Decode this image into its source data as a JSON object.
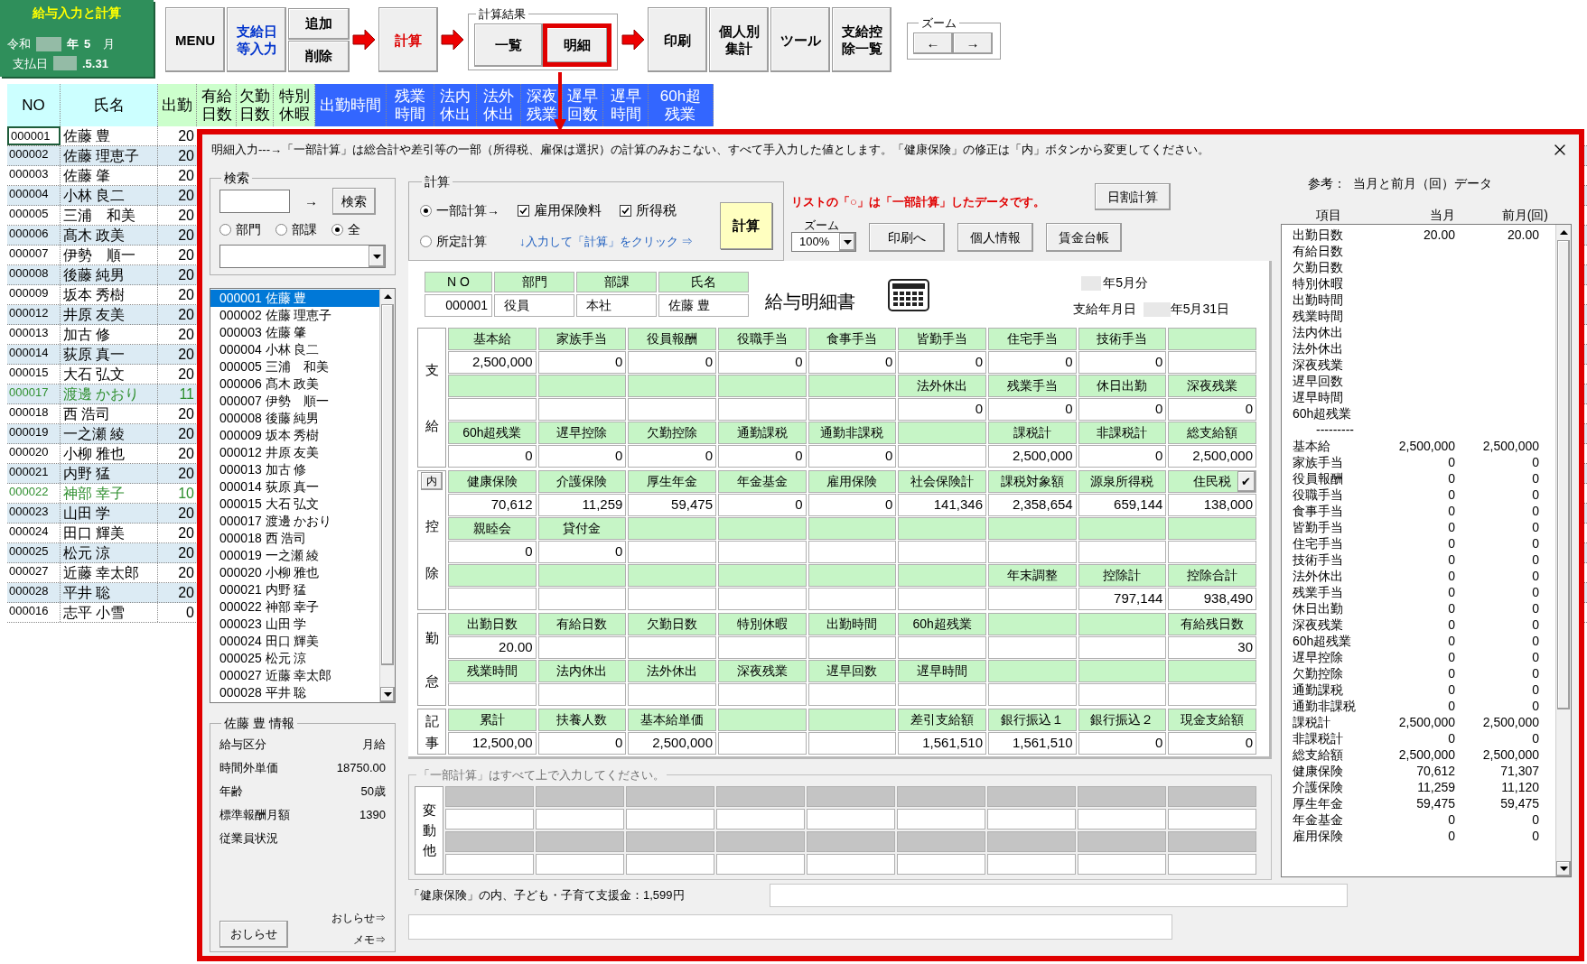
{
  "badge": {
    "title": "給与入力と計算",
    "era": "令和",
    "year_unit": "年",
    "month": "5",
    "month_unit": "月",
    "pay_label": "支払日",
    "pay_date": ".5.31"
  },
  "toolbar": {
    "items": [
      {
        "kind": "button",
        "label": "MENU"
      },
      {
        "kind": "button",
        "label": "支給日等入力",
        "color": "#0033cc"
      },
      {
        "kind": "stack",
        "labels": [
          "追加",
          "削除"
        ]
      },
      {
        "kind": "arrow"
      },
      {
        "kind": "button",
        "label": "計算",
        "color": "#dd0000"
      },
      {
        "kind": "arrow"
      },
      {
        "kind": "group",
        "title": "計算結果",
        "buttons": [
          {
            "label": "一覧",
            "selected": false
          },
          {
            "label": "明細",
            "selected": true
          }
        ]
      },
      {
        "kind": "arrow"
      },
      {
        "kind": "button",
        "label": "印刷"
      },
      {
        "kind": "button",
        "label": "個人別集計"
      },
      {
        "kind": "button",
        "label": "ツール"
      },
      {
        "kind": "button",
        "label": "支給控除一覧"
      },
      {
        "kind": "zoom",
        "title": "ズーム",
        "buttons": [
          "←",
          "→"
        ]
      }
    ]
  },
  "sheet": {
    "columns": [
      {
        "label": "NO",
        "color": "#ccffff"
      },
      {
        "label": "氏名",
        "color": "#ccffff"
      },
      {
        "label": "出勤",
        "color": "#ccffcc"
      },
      {
        "label": "有給日数",
        "color": "#ccffcc"
      },
      {
        "label": "欠勤日数",
        "color": "#ccffcc"
      },
      {
        "label": "特別休暇",
        "color": "#ccffcc"
      },
      {
        "label": "出勤時間",
        "color": "#3366ff"
      },
      {
        "label": "残業時間",
        "color": "#3366ff"
      },
      {
        "label": "法内休出",
        "color": "#3366ff"
      },
      {
        "label": "法外休出",
        "color": "#3366ff"
      },
      {
        "label": "深夜残業",
        "color": "#3366ff"
      },
      {
        "label": "遅早回数",
        "color": "#3366ff"
      },
      {
        "label": "遅早時間",
        "color": "#3366ff"
      },
      {
        "label": "60h超残業",
        "color": "#3366ff"
      }
    ],
    "rows": [
      {
        "no": "000001",
        "name": "佐藤 豊",
        "days": "20",
        "selected": true,
        "partial": false
      },
      {
        "no": "000002",
        "name": "佐藤 理恵子",
        "days": "20",
        "selected": false,
        "partial": false
      },
      {
        "no": "000003",
        "name": "佐藤 肇",
        "days": "20",
        "selected": false,
        "partial": false
      },
      {
        "no": "000004",
        "name": "小林 良二",
        "days": "20",
        "selected": false,
        "partial": false
      },
      {
        "no": "000005",
        "name": "三浦　和美",
        "days": "20",
        "selected": false,
        "partial": false
      },
      {
        "no": "000006",
        "name": "髙木 政美",
        "days": "20",
        "selected": false,
        "partial": false
      },
      {
        "no": "000007",
        "name": "伊勢　順一",
        "days": "20",
        "selected": false,
        "partial": false
      },
      {
        "no": "000008",
        "name": "後藤 純男",
        "days": "20",
        "selected": false,
        "partial": false
      },
      {
        "no": "000009",
        "name": "坂本 秀樹",
        "days": "20",
        "selected": false,
        "partial": false
      },
      {
        "no": "000012",
        "name": "井原 友美",
        "days": "20",
        "selected": false,
        "partial": false
      },
      {
        "no": "000013",
        "name": "加古 修",
        "days": "20",
        "selected": false,
        "partial": false
      },
      {
        "no": "000014",
        "name": "荻原 真一",
        "days": "20",
        "selected": false,
        "partial": false
      },
      {
        "no": "000015",
        "name": "大石 弘文",
        "days": "20",
        "selected": false,
        "partial": false
      },
      {
        "no": "000017",
        "name": "渡邊 かおり",
        "days": "11",
        "selected": false,
        "partial": true
      },
      {
        "no": "000018",
        "name": "西 浩司",
        "days": "20",
        "selected": false,
        "partial": false
      },
      {
        "no": "000019",
        "name": "一之瀬 綾",
        "days": "20",
        "selected": false,
        "partial": false
      },
      {
        "no": "000020",
        "name": "小柳 雅也",
        "days": "20",
        "selected": false,
        "partial": false
      },
      {
        "no": "000021",
        "name": "内野 猛",
        "days": "20",
        "selected": false,
        "partial": false
      },
      {
        "no": "000022",
        "name": "神部 幸子",
        "days": "10",
        "selected": false,
        "partial": true
      },
      {
        "no": "000023",
        "name": "山田 学",
        "days": "20",
        "selected": false,
        "partial": false
      },
      {
        "no": "000024",
        "name": "田口 輝美",
        "days": "20",
        "selected": false,
        "partial": false
      },
      {
        "no": "000025",
        "name": "松元 涼",
        "days": "20",
        "selected": false,
        "partial": false
      },
      {
        "no": "000027",
        "name": "近藤 幸太郎",
        "days": "20",
        "selected": false,
        "partial": false
      },
      {
        "no": "000028",
        "name": "平井 聡",
        "days": "20",
        "selected": false,
        "partial": false
      },
      {
        "no": "000016",
        "name": "志平 小雪",
        "days": "0",
        "selected": false,
        "partial": false
      }
    ]
  },
  "dialog": {
    "message": "明細入力---→「一部計算」は総合計や差引等の一部（所得税、雇保は選択）の計算のみおこない、すべて手入力した値とします。「健康保険」の修正は「内」ボタンから変更してください。",
    "search": {
      "title": "検索",
      "arrow": "→",
      "button": "検索",
      "radios": [
        {
          "label": "部門",
          "selected": false
        },
        {
          "label": "部課",
          "selected": false
        },
        {
          "label": "全",
          "selected": true
        }
      ]
    },
    "employees": [
      {
        "text": "000001 佐藤 豊",
        "selected": true
      },
      {
        "text": "000002 佐藤 理恵子",
        "selected": false
      },
      {
        "text": "000003 佐藤 肇",
        "selected": false
      },
      {
        "text": "000004 小林 良二",
        "selected": false
      },
      {
        "text": "000005 三浦　和美",
        "selected": false
      },
      {
        "text": "000006 髙木 政美",
        "selected": false
      },
      {
        "text": "000007 伊勢　順一",
        "selected": false
      },
      {
        "text": "000008 後藤 純男",
        "selected": false
      },
      {
        "text": "000009 坂本 秀樹",
        "selected": false
      },
      {
        "text": "000012 井原 友美",
        "selected": false
      },
      {
        "text": "000013 加古 修",
        "selected": false
      },
      {
        "text": "000014 荻原 真一",
        "selected": false
      },
      {
        "text": "000015 大石 弘文",
        "selected": false
      },
      {
        "text": "000017 渡邊 かおり",
        "selected": false
      },
      {
        "text": "000018 西 浩司",
        "selected": false
      },
      {
        "text": "000019 一之瀬 綾",
        "selected": false
      },
      {
        "text": "000020 小柳 雅也",
        "selected": false
      },
      {
        "text": "000021 内野 猛",
        "selected": false
      },
      {
        "text": "000022 神部 幸子",
        "selected": false
      },
      {
        "text": "000023 山田 学",
        "selected": false
      },
      {
        "text": "000024 田口 輝美",
        "selected": false
      },
      {
        "text": "000025 松元 涼",
        "selected": false
      },
      {
        "text": "000027 近藤 幸太郎",
        "selected": false
      },
      {
        "text": "000028 平井 聡",
        "selected": false
      }
    ],
    "info": {
      "title": "佐藤 豊 情報",
      "rows": [
        {
          "label": "給与区分",
          "value": "月給"
        },
        {
          "label": "時間外単価",
          "value": "18750.00"
        },
        {
          "label": "年齢",
          "value": "50歳"
        },
        {
          "label": "標準報酬月額",
          "value": "1390"
        },
        {
          "label": "従業員状況"
        }
      ],
      "notice_button": "おしらせ",
      "notice_label": "おしらせ⇒",
      "memo_label": "メモ⇒"
    },
    "calc": {
      "title": "計算",
      "modes": [
        {
          "label": "一部計算→",
          "selected": true
        },
        {
          "label": "所定計算",
          "selected": false
        }
      ],
      "checks": [
        {
          "label": "雇用保険料",
          "checked": true
        },
        {
          "label": "所得税",
          "checked": true
        }
      ],
      "hint": "↓入力して「計算」をクリック ⇒",
      "button": "計算"
    },
    "legend_note": "リストの「○」は「一部計算」したデータです。",
    "zoom": {
      "label": "ズーム",
      "value": "100%"
    },
    "buttons": [
      "日割計算",
      "印刷へ",
      "個人情報",
      "賃金台帳"
    ],
    "slip": {
      "id_headers": [
        "N O",
        "部門",
        "部課",
        "氏名"
      ],
      "id_values": [
        "000001",
        "役員",
        "本社",
        "佐藤 豊"
      ],
      "title": "給与明細書",
      "period": "年5月分",
      "pay_date_label": "支給年月日",
      "pay_date": "年5月31日",
      "sections": [
        {
          "label": "支給",
          "pairs": [
            {
              "cells": [
                {
                  "header": "基本給",
                  "value": "2,500,000"
                },
                {
                  "header": "家族手当",
                  "value": "0"
                },
                {
                  "header": "役員報酬",
                  "value": "0"
                },
                {
                  "header": "役職手当",
                  "value": "0"
                },
                {
                  "header": "食事手当",
                  "value": "0"
                },
                {
                  "header": "皆勤手当",
                  "value": "0"
                },
                {
                  "header": "住宅手当",
                  "value": "0"
                },
                {
                  "header": "技術手当",
                  "value": "0"
                },
                {}
              ]
            },
            {
              "cells": [
                {},
                {},
                {},
                {},
                {},
                {
                  "header": "法外休出",
                  "value": "0"
                },
                {
                  "header": "残業手当",
                  "value": "0"
                },
                {
                  "header": "休日出勤",
                  "value": "0"
                },
                {
                  "header": "深夜残業",
                  "value": "0"
                }
              ]
            },
            {
              "cells": [
                {
                  "header": "60h超残業",
                  "value": "0"
                },
                {
                  "header": "遅早控除",
                  "value": "0"
                },
                {
                  "header": "欠勤控除",
                  "value": "0"
                },
                {
                  "header": "通勤課税",
                  "value": "0"
                },
                {
                  "header": "通勤非課税",
                  "value": "0"
                },
                {},
                {
                  "header": "課税計",
                  "value": "2,500,000"
                },
                {
                  "header": "非課税計",
                  "value": "0"
                },
                {
                  "header": "総支給額",
                  "value": "2,500,000"
                }
              ]
            }
          ]
        },
        {
          "label": "控除",
          "button": "内",
          "pairs": [
            {
              "cells": [
                {
                  "header": "健康保険",
                  "value": "70,612"
                },
                {
                  "header": "介護保険",
                  "value": "11,259"
                },
                {
                  "header": "厚生年金",
                  "value": "59,475"
                },
                {
                  "header": "年金基金",
                  "value": "0"
                },
                {
                  "header": "雇用保険",
                  "value": "0"
                },
                {
                  "header": "社会保険計",
                  "value": "141,346"
                },
                {
                  "header": "課税対象額",
                  "value": "2,358,654"
                },
                {
                  "header": "源泉所得税",
                  "value": "659,144"
                },
                {
                  "header": "住民税",
                  "value": "138,000",
                  "button": "✔"
                }
              ]
            },
            {
              "cells": [
                {
                  "header": "親睦会",
                  "value": "0"
                },
                {
                  "header": "貸付金",
                  "value": "0"
                },
                {},
                {},
                {},
                {},
                {},
                {},
                {}
              ]
            },
            {
              "cells": [
                {},
                {},
                {},
                {},
                {},
                {},
                {
                  "header": "年末調整"
                },
                {
                  "header": "控除計",
                  "value": "797,144"
                },
                {
                  "header": "控除合計",
                  "value": "938,490"
                }
              ]
            }
          ]
        },
        {
          "label": "勤怠",
          "pairs": [
            {
              "cells": [
                {
                  "header": "出勤日数",
                  "value": "20.00"
                },
                {
                  "header": "有給日数"
                },
                {
                  "header": "欠勤日数"
                },
                {
                  "header": "特別休暇"
                },
                {
                  "header": "出勤時間"
                },
                {
                  "header": "60h超残業"
                },
                {},
                {},
                {
                  "header": "有給残日数",
                  "value": "30"
                }
              ]
            },
            {
              "cells": [
                {
                  "header": "残業時間"
                },
                {
                  "header": "法内休出"
                },
                {
                  "header": "法外休出"
                },
                {
                  "header": "深夜残業"
                },
                {
                  "header": "遅早回数"
                },
                {
                  "header": "遅早時間"
                },
                {},
                {},
                {}
              ]
            }
          ]
        },
        {
          "label": "記事",
          "pairs": [
            {
              "cells": [
                {
                  "header": "累計",
                  "value": "12,500,00"
                },
                {
                  "header": "扶養人数",
                  "value": "0"
                },
                {
                  "header": "基本給単価",
                  "value": "2,500,000"
                },
                {},
                {},
                {
                  "header": "差引支給額",
                  "value": "1,561,510"
                },
                {
                  "header": "銀行振込１",
                  "value": "1,561,510"
                },
                {
                  "header": "銀行振込２",
                  "value": "0"
                },
                {
                  "header": "現金支給額",
                  "value": "0"
                }
              ]
            }
          ]
        }
      ]
    },
    "changes": {
      "title": "「一部計算」はすべて上で入力してください。",
      "label": "変動他"
    },
    "support_note": "「健康保険」の内、子ども・子育て支援金：1,599円",
    "reference": {
      "title": "参考：  当月と前月（回）データ",
      "columns": [
        "項目",
        "当月",
        "前月(回)"
      ],
      "rows": [
        {
          "kind": "item",
          "label": "出勤日数",
          "current": "20.00",
          "previous": "20.00"
        },
        {
          "kind": "item",
          "label": "有給日数"
        },
        {
          "kind": "item",
          "label": "欠勤日数"
        },
        {
          "kind": "item",
          "label": "特別休暇"
        },
        {
          "kind": "item",
          "label": "出勤時間"
        },
        {
          "kind": "item",
          "label": "残業時間"
        },
        {
          "kind": "item",
          "label": "法内休出"
        },
        {
          "kind": "item",
          "label": "法外休出"
        },
        {
          "kind": "item",
          "label": "深夜残業"
        },
        {
          "kind": "item",
          "label": "遅早回数"
        },
        {
          "kind": "item",
          "label": "遅早時間"
        },
        {
          "kind": "item",
          "label": "60h超残業"
        },
        {
          "kind": "separator",
          "label": "---------"
        },
        {
          "kind": "item",
          "label": "基本給",
          "current": "2,500,000",
          "previous": "2,500,000"
        },
        {
          "kind": "item",
          "label": "家族手当",
          "current": "0",
          "previous": "0"
        },
        {
          "kind": "item",
          "label": "役員報酬",
          "current": "0",
          "previous": "0"
        },
        {
          "kind": "item",
          "label": "役職手当",
          "current": "0",
          "previous": "0"
        },
        {
          "kind": "item",
          "label": "食事手当",
          "current": "0",
          "previous": "0"
        },
        {
          "kind": "item",
          "label": "皆勤手当",
          "current": "0",
          "previous": "0"
        },
        {
          "kind": "item",
          "label": "住宅手当",
          "current": "0",
          "previous": "0"
        },
        {
          "kind": "item",
          "label": "技術手当",
          "current": "0",
          "previous": "0"
        },
        {
          "kind": "item",
          "label": "法外休出",
          "current": "0",
          "previous": "0"
        },
        {
          "kind": "item",
          "label": "残業手当",
          "current": "0",
          "previous": "0"
        },
        {
          "kind": "item",
          "label": "休日出勤",
          "current": "0",
          "previous": "0"
        },
        {
          "kind": "item",
          "label": "深夜残業",
          "current": "0",
          "previous": "0"
        },
        {
          "kind": "item",
          "label": "60h超残業",
          "current": "0",
          "previous": "0"
        },
        {
          "kind": "item",
          "label": "遅早控除",
          "current": "0",
          "previous": "0"
        },
        {
          "kind": "item",
          "label": "欠勤控除",
          "current": "0",
          "previous": "0"
        },
        {
          "kind": "item",
          "label": "通勤課税",
          "current": "0",
          "previous": "0"
        },
        {
          "kind": "item",
          "label": "通勤非課税",
          "current": "0",
          "previous": "0"
        },
        {
          "kind": "item",
          "label": "課税計",
          "current": "2,500,000",
          "previous": "2,500,000"
        },
        {
          "kind": "item",
          "label": "非課税計",
          "current": "0",
          "previous": "0"
        },
        {
          "kind": "item",
          "label": "総支給額",
          "current": "2,500,000",
          "previous": "2,500,000"
        },
        {
          "kind": "item",
          "label": "健康保険",
          "current": "70,612",
          "previous": "71,307"
        },
        {
          "kind": "item",
          "label": "介護保険",
          "current": "11,259",
          "previous": "11,120"
        },
        {
          "kind": "item",
          "label": "厚生年金",
          "current": "59,475",
          "previous": "59,475"
        },
        {
          "kind": "item",
          "label": "年金基金",
          "current": "0",
          "previous": "0"
        },
        {
          "kind": "item",
          "label": "雇用保険",
          "current": "0",
          "previous": "0"
        }
      ]
    }
  }
}
